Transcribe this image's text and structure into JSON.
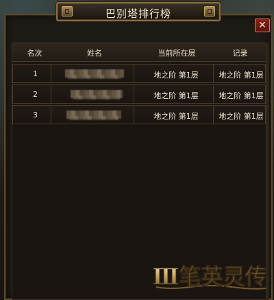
{
  "window": {
    "title": "巴别塔排行榜",
    "close_label": "✕"
  },
  "table": {
    "columns": [
      "名次",
      "姓名",
      "当前所在层",
      "记录"
    ],
    "rows": [
      {
        "rank": "1",
        "layer": "地之阶 第1层",
        "record": "地之阶 第1层"
      },
      {
        "rank": "2",
        "layer": "地之阶 第1层",
        "record": "地之阶 第1层"
      },
      {
        "rank": "3",
        "layer": "地之阶 第1层",
        "record": "地之阶 第1层"
      }
    ]
  },
  "logo": {
    "text": "Ⅲ笔英灵传"
  },
  "colors": {
    "frame_gold": "#8a6d3e",
    "close_red": "#8c1f12",
    "text_light": "#f0e6d2"
  }
}
